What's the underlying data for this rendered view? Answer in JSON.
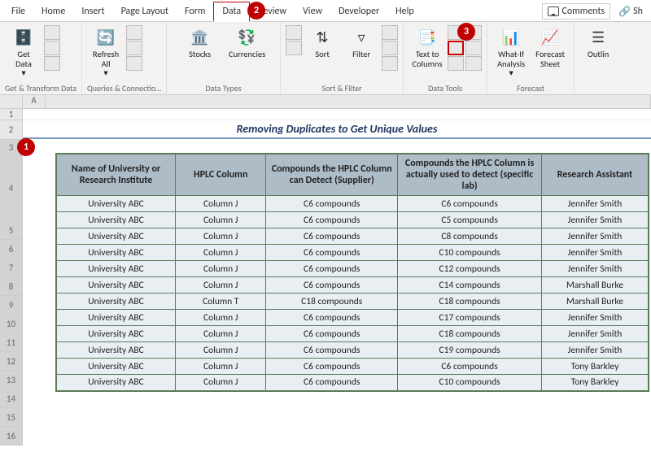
{
  "callouts": {
    "c1": "1",
    "c2": "2",
    "c3": "3"
  },
  "tabs": {
    "file": "File",
    "home": "Home",
    "insert": "Insert",
    "page_layout": "Page Layout",
    "formulas": "Form",
    "data": "Data",
    "review": "Review",
    "view": "View",
    "developer": "Developer",
    "help": "Help"
  },
  "right": {
    "comments": "Comments",
    "share": "Sh"
  },
  "ribbon": {
    "g1": {
      "btn": "Get\nData",
      "label": "Get & Transform Data"
    },
    "g2": {
      "btn": "Refresh\nAll",
      "label": "Queries & Connectio…"
    },
    "g3": {
      "stocks": "Stocks",
      "currencies": "Currencies",
      "label": "Data Types"
    },
    "g4": {
      "sort": "Sort",
      "filter": "Filter",
      "label": "Sort & Filter"
    },
    "g5": {
      "t2c": "Text to\nColumns",
      "label": "Data Tools"
    },
    "g6": {
      "whatif": "What-If\nAnalysis",
      "forecast": "Forecast\nSheet",
      "label": "Forecast"
    },
    "g7": {
      "outline": "Outlin"
    }
  },
  "sheet": {
    "title": "Removing Duplicates to Get Unique Values",
    "headers": [
      "Name of University or Research Institute",
      "HPLC Column",
      "Compounds the HPLC Column can Detect (Supplier)",
      "Compounds the HPLC Column is actually used to detect (specific lab)",
      "Research Assistant"
    ],
    "rows": [
      [
        "University ABC",
        "Column J",
        "C6 compounds",
        "C6 compounds",
        "Jennifer Smith"
      ],
      [
        "University ABC",
        "Column J",
        "C6 compounds",
        "C5 compounds",
        "Jennifer Smith"
      ],
      [
        "University ABC",
        "Column J",
        "C6 compounds",
        "C8 compounds",
        "Jennifer Smith"
      ],
      [
        "University ABC",
        "Column J",
        "C6 compounds",
        "C10 compounds",
        "Jennifer Smith"
      ],
      [
        "University ABC",
        "Column J",
        "C6 compounds",
        "C12 compounds",
        "Jennifer Smith"
      ],
      [
        "University ABC",
        "Column J",
        "C6 compounds",
        "C14 compounds",
        "Marshall Burke"
      ],
      [
        "University ABC",
        "Column T",
        "C18 compounds",
        "C18 compounds",
        "Marshall Burke"
      ],
      [
        "University ABC",
        "Column J",
        "C6 compounds",
        "C17 compounds",
        "Jennifer Smith"
      ],
      [
        "University ABC",
        "Column J",
        "C6 compounds",
        "C18 compounds",
        "Jennifer Smith"
      ],
      [
        "University ABC",
        "Column J",
        "C6 compounds",
        "C19 compounds",
        "Jennifer Smith"
      ],
      [
        "University ABC",
        "Column J",
        "C6 compounds",
        "C6 compounds",
        "Tony Barkley"
      ],
      [
        "University ABC",
        "Column J",
        "C6 compounds",
        "C10 compounds",
        "Tony Barkley"
      ]
    ],
    "rownums": [
      "1",
      "2",
      "3",
      "4",
      "5",
      "6",
      "7",
      "8",
      "9",
      "10",
      "11",
      "12",
      "13",
      "14",
      "15",
      "16"
    ],
    "colletters": [
      "A"
    ]
  }
}
